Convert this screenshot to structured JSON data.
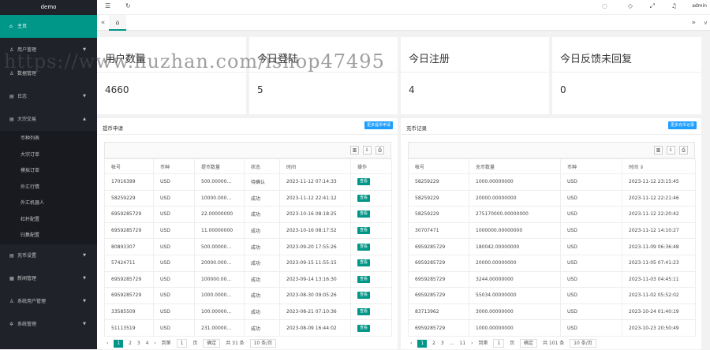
{
  "app": {
    "logo": "demo",
    "admin": "admin"
  },
  "sidebar": {
    "home": "主页",
    "items": [
      {
        "label": "用户管理"
      },
      {
        "label": "数据管理"
      },
      {
        "label": "日志"
      },
      {
        "label": "大宗交易"
      }
    ],
    "sub_items": [
      "币种列表",
      "大宗订单",
      "模拟订单",
      "外汇行情",
      "外汇机器人",
      "杠杆配置",
      "归集配置"
    ],
    "items2": [
      {
        "label": "充币设置"
      },
      {
        "label": "新闻管理"
      },
      {
        "label": "系统用户管理"
      },
      {
        "label": "系统管理"
      }
    ]
  },
  "tabs": {
    "left": "«",
    "right": "»",
    "home_icon": "⌂"
  },
  "stats": [
    {
      "title": "用户数量",
      "value": "4660"
    },
    {
      "title": "今日登陆",
      "value": "5"
    },
    {
      "title": "今日注册",
      "value": "4"
    },
    {
      "title": "今日反馈未回复",
      "value": "0"
    }
  ],
  "withdraw": {
    "title": "提币申请",
    "more": "更多提币申请",
    "headers": [
      "帐号",
      "币种",
      "提币数量",
      "状态",
      "时间",
      "操作"
    ],
    "action": "查看",
    "rows": [
      [
        "17016399",
        "USD",
        "500.00000...",
        "待确认",
        "2023-11-12 07:14:33"
      ],
      [
        "58259229",
        "USD",
        "10000.000...",
        "成功",
        "2023-11-12 22:41:12"
      ],
      [
        "6959285729",
        "USD",
        "22.00000000",
        "成功",
        "2023-10-16 08:18:25"
      ],
      [
        "6959285729",
        "USD",
        "11.00000000",
        "成功",
        "2023-10-16 08:17:52"
      ],
      [
        "80893307",
        "USD",
        "500.00000...",
        "成功",
        "2023-09-20 17:55:26"
      ],
      [
        "57424711",
        "USD",
        "20000.000...",
        "成功",
        "2023-09-15 11:55:15"
      ],
      [
        "6959285729",
        "USD",
        "100000.00...",
        "成功",
        "2023-09-14 13:16:30"
      ],
      [
        "6959285729",
        "USD",
        "1000.0000...",
        "成功",
        "2023-08-30 09:05:26"
      ],
      [
        "33585509",
        "USD",
        "100.00000...",
        "成功",
        "2023-08-21 07:10:36"
      ],
      [
        "51113519",
        "USD",
        "231.00000...",
        "成功",
        "2023-08-09 16:44:02"
      ]
    ],
    "pager": {
      "pages": [
        "2",
        "3",
        "4"
      ],
      "current": "1",
      "goto": "到第",
      "page_input": "1",
      "page_unit": "页",
      "confirm": "确定",
      "total": "共 31 条",
      "per_page": "10 条/页"
    }
  },
  "deposit": {
    "title": "充币记录",
    "more": "更多充币记录",
    "headers": [
      "帐号",
      "充币数量",
      "币种",
      "时间 ⇕"
    ],
    "rows": [
      [
        "58259229",
        "1000.00000000",
        "USD",
        "2023-11-12 23:15:45"
      ],
      [
        "58259229",
        "20000.00000000",
        "USD",
        "2023-11-12 22:21:46"
      ],
      [
        "58259229",
        "275170000.00000000",
        "USD",
        "2023-11-12 22:20:42"
      ],
      [
        "30707471",
        "1000000.00000000",
        "USD",
        "2023-11-12 14:10:27"
      ],
      [
        "6959285729",
        "180042.00000000",
        "USD",
        "2023-11-09 06:36:48"
      ],
      [
        "6959285729",
        "20000.00000000",
        "USD",
        "2023-11-05 07:41:23"
      ],
      [
        "6959285729",
        "3244.00000000",
        "USD",
        "2023-11-03 04:45:11"
      ],
      [
        "6959285729",
        "55034.00000000",
        "USD",
        "2023-11-02 05:52:02"
      ],
      [
        "83713962",
        "3000.00000000",
        "USD",
        "2023-10-24 01:40:19"
      ],
      [
        "6959285729",
        "1000.00000000",
        "USD",
        "2023-10-23 20:50:49"
      ]
    ],
    "pager": {
      "pages": [
        "2",
        "3",
        "…",
        "11"
      ],
      "current": "1",
      "goto": "到第",
      "page_input": "1",
      "page_unit": "页",
      "confirm": "确定",
      "total": "共 101 条",
      "per_page": "10 条/页"
    }
  },
  "watermark": "https://www.huzhan.com/ishop47495",
  "colors": {
    "sidebar": "#20222a",
    "accent": "#009688",
    "blue": "#1e9fff"
  }
}
